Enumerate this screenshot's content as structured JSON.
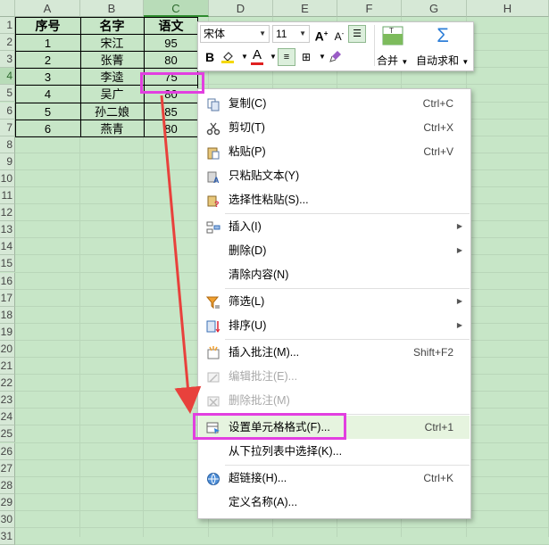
{
  "columns": [
    "A",
    "B",
    "C",
    "D",
    "E",
    "F",
    "G",
    "H"
  ],
  "selected_column": "C",
  "row_numbers": [
    "1",
    "2",
    "3",
    "4",
    "5",
    "6",
    "7",
    "8",
    "9",
    "10",
    "11",
    "12",
    "13",
    "14",
    "15",
    "16",
    "17",
    "18",
    "19",
    "20",
    "21",
    "22",
    "23",
    "24",
    "25",
    "26",
    "27",
    "28",
    "29",
    "30",
    "31"
  ],
  "selected_row": "4",
  "table": {
    "headers": [
      "序号",
      "名字",
      "语文"
    ],
    "rows": [
      [
        "1",
        "宋江",
        "95"
      ],
      [
        "2",
        "张菁",
        "80"
      ],
      [
        "3",
        "李逵",
        "75"
      ],
      [
        "4",
        "吴广",
        "80"
      ],
      [
        "5",
        "孙二娘",
        "85"
      ],
      [
        "6",
        "燕青",
        "80"
      ]
    ]
  },
  "toolbar": {
    "font_name": "宋体",
    "font_size": "11",
    "merge_label": "合并",
    "autosum_label": "自动求和"
  },
  "context_menu": {
    "items": [
      {
        "label": "复制(C)",
        "shortcut": "Ctrl+C",
        "icon": "copy-icon",
        "disabled": false
      },
      {
        "label": "剪切(T)",
        "shortcut": "Ctrl+X",
        "icon": "cut-icon",
        "disabled": false
      },
      {
        "label": "粘贴(P)",
        "shortcut": "Ctrl+V",
        "icon": "paste-icon",
        "disabled": false
      },
      {
        "label": "只粘贴文本(Y)",
        "shortcut": "",
        "icon": "paste-text-icon",
        "disabled": false
      },
      {
        "label": "选择性粘贴(S)...",
        "shortcut": "",
        "icon": "paste-special-icon",
        "disabled": false
      },
      {
        "label": "插入(I)",
        "shortcut": "",
        "icon": "insert-icon",
        "disabled": false,
        "submenu": true
      },
      {
        "label": "删除(D)",
        "shortcut": "",
        "icon": "",
        "disabled": false,
        "submenu": true
      },
      {
        "label": "清除内容(N)",
        "shortcut": "",
        "icon": "",
        "disabled": false
      },
      {
        "label": "筛选(L)",
        "shortcut": "",
        "icon": "filter-icon",
        "disabled": false,
        "submenu": true
      },
      {
        "label": "排序(U)",
        "shortcut": "",
        "icon": "sort-icon",
        "disabled": false,
        "submenu": true
      },
      {
        "label": "插入批注(M)...",
        "shortcut": "Shift+F2",
        "icon": "insert-comment-icon",
        "disabled": false
      },
      {
        "label": "编辑批注(E)...",
        "shortcut": "",
        "icon": "edit-comment-icon",
        "disabled": true
      },
      {
        "label": "删除批注(M)",
        "shortcut": "",
        "icon": "delete-comment-icon",
        "disabled": true
      },
      {
        "label": "设置单元格格式(F)...",
        "shortcut": "Ctrl+1",
        "icon": "format-cells-icon",
        "disabled": false,
        "highlighted": true
      },
      {
        "label": "从下拉列表中选择(K)...",
        "shortcut": "",
        "icon": "",
        "disabled": false
      },
      {
        "label": "超链接(H)...",
        "shortcut": "Ctrl+K",
        "icon": "hyperlink-icon",
        "disabled": false
      },
      {
        "label": "定义名称(A)...",
        "shortcut": "",
        "icon": "",
        "disabled": false
      }
    ]
  },
  "colors": {
    "sheet_bg": "#c7e6c7",
    "highlight_box": "#e23fe0",
    "arrow": "#e8413c",
    "menu_highlight": "#e6f4df"
  }
}
